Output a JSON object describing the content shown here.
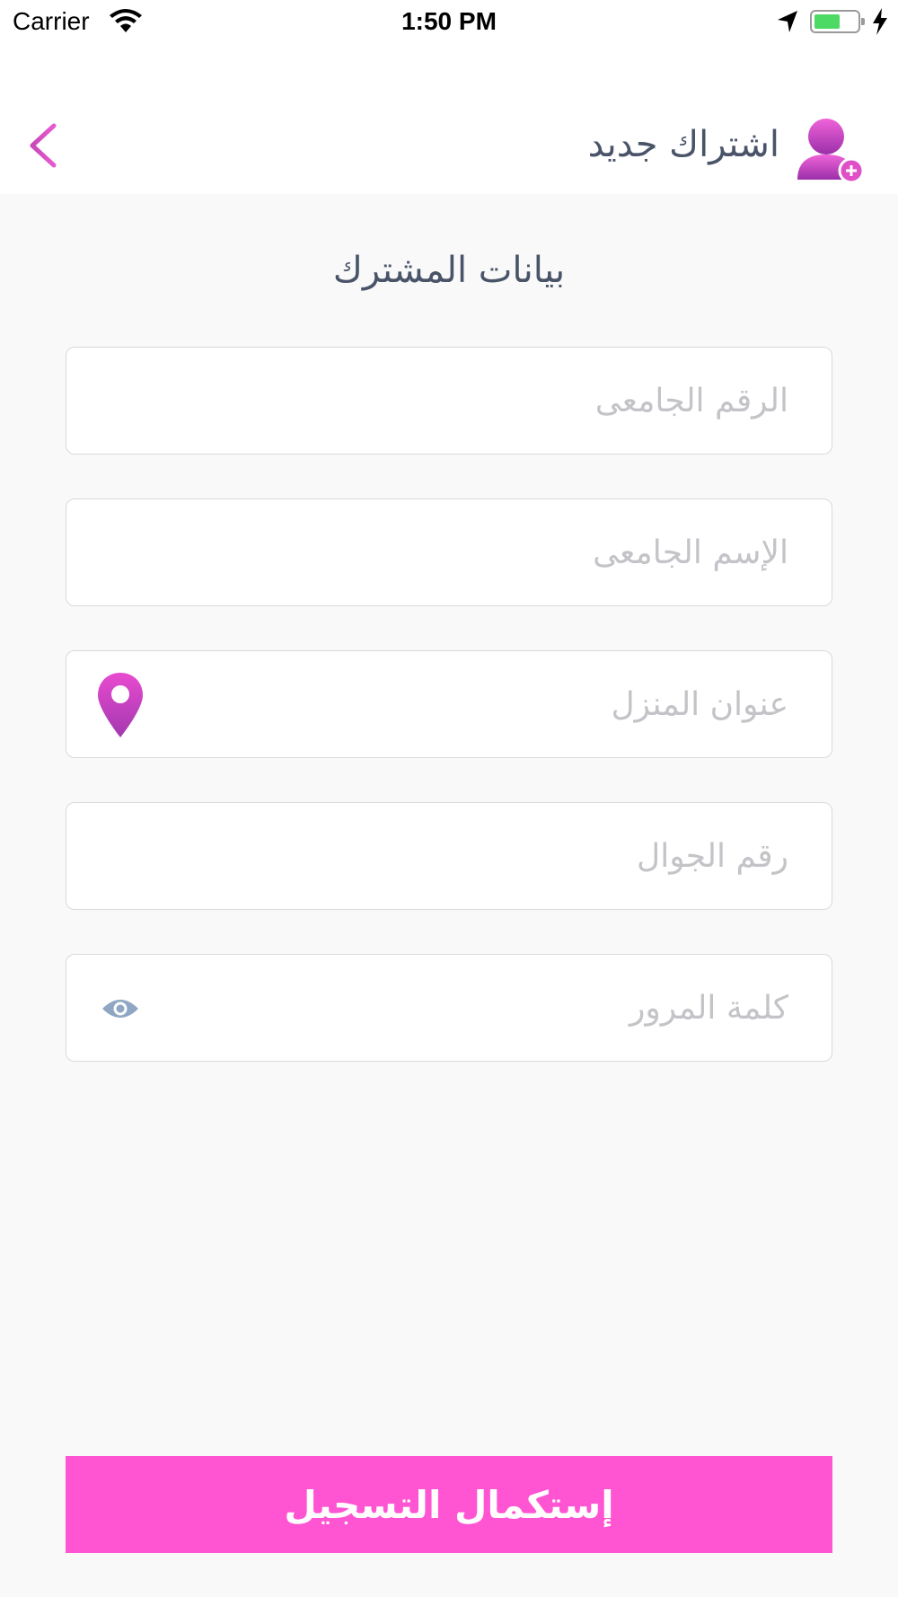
{
  "status_bar": {
    "carrier": "Carrier",
    "time": "1:50 PM",
    "icons": [
      "wifi-icon",
      "location-arrow-icon",
      "battery-icon",
      "charging-bolt-icon"
    ]
  },
  "header": {
    "title": "اشتراك جديد",
    "back_icon": "arrow-left-icon",
    "title_icon": "add-user-icon"
  },
  "form": {
    "section_title": "بيانات المشترك",
    "fields": [
      {
        "placeholder": "الرقم الجامعى",
        "value": ""
      },
      {
        "placeholder": "الإسم الجامعى",
        "value": ""
      },
      {
        "placeholder": "عنوان المنزل",
        "value": "",
        "icon": "map-pin-icon"
      },
      {
        "placeholder": "رقم الجوال",
        "value": ""
      },
      {
        "placeholder": "كلمة المرور",
        "value": "",
        "icon": "eye-icon"
      }
    ],
    "submit_label": "إستكمال التسجيل"
  },
  "colors": {
    "accent": "#ff55d2",
    "pin_gradient": [
      "#e84bcf",
      "#a338b0"
    ],
    "title_text": "#4a5468",
    "placeholder_text": "#c3c3c8",
    "eye_icon": "#8fa6c4",
    "background": "#f9f9fa"
  }
}
